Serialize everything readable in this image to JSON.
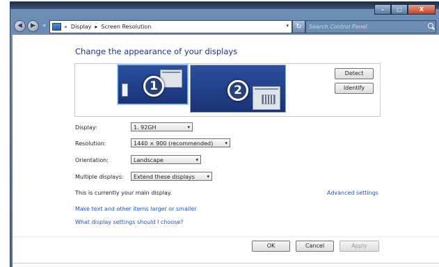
{
  "window": {
    "controls": {
      "minimize": "",
      "maximize": "",
      "close": "X"
    }
  },
  "navigation": {
    "back_glyph": "◀",
    "forward_glyph": "▶",
    "breadcrumb_prefix": "«",
    "breadcrumbs": [
      "Display",
      "Screen Resolution"
    ],
    "separator": "▸",
    "search_placeholder": "Search Control Panel"
  },
  "page": {
    "title": "Change the appearance of your displays",
    "monitors": [
      {
        "number": "1",
        "selected": true
      },
      {
        "number": "2",
        "selected": false
      }
    ],
    "detect_label": "Detect",
    "identify_label": "Identify"
  },
  "settings": {
    "display": {
      "label": "Display:",
      "value": "1. 92GH"
    },
    "resolution": {
      "label": "Resolution:",
      "value": "1440 × 900 (recommended)"
    },
    "orientation": {
      "label": "Orientation:",
      "value": "Landscape"
    },
    "multiple": {
      "label": "Multiple displays:",
      "value": "Extend these displays"
    }
  },
  "status": {
    "main_display_text": "This is currently your main display.",
    "advanced_link": "Advanced settings"
  },
  "links": {
    "text_size": "Make text and other items larger or smaller",
    "help": "What display settings should I choose?"
  },
  "footer": {
    "ok": "OK",
    "cancel": "Cancel",
    "apply": "Apply"
  },
  "colors": {
    "title": "#1e3287",
    "link": "#1b55c8",
    "monitor_fill": "#1a3378"
  }
}
